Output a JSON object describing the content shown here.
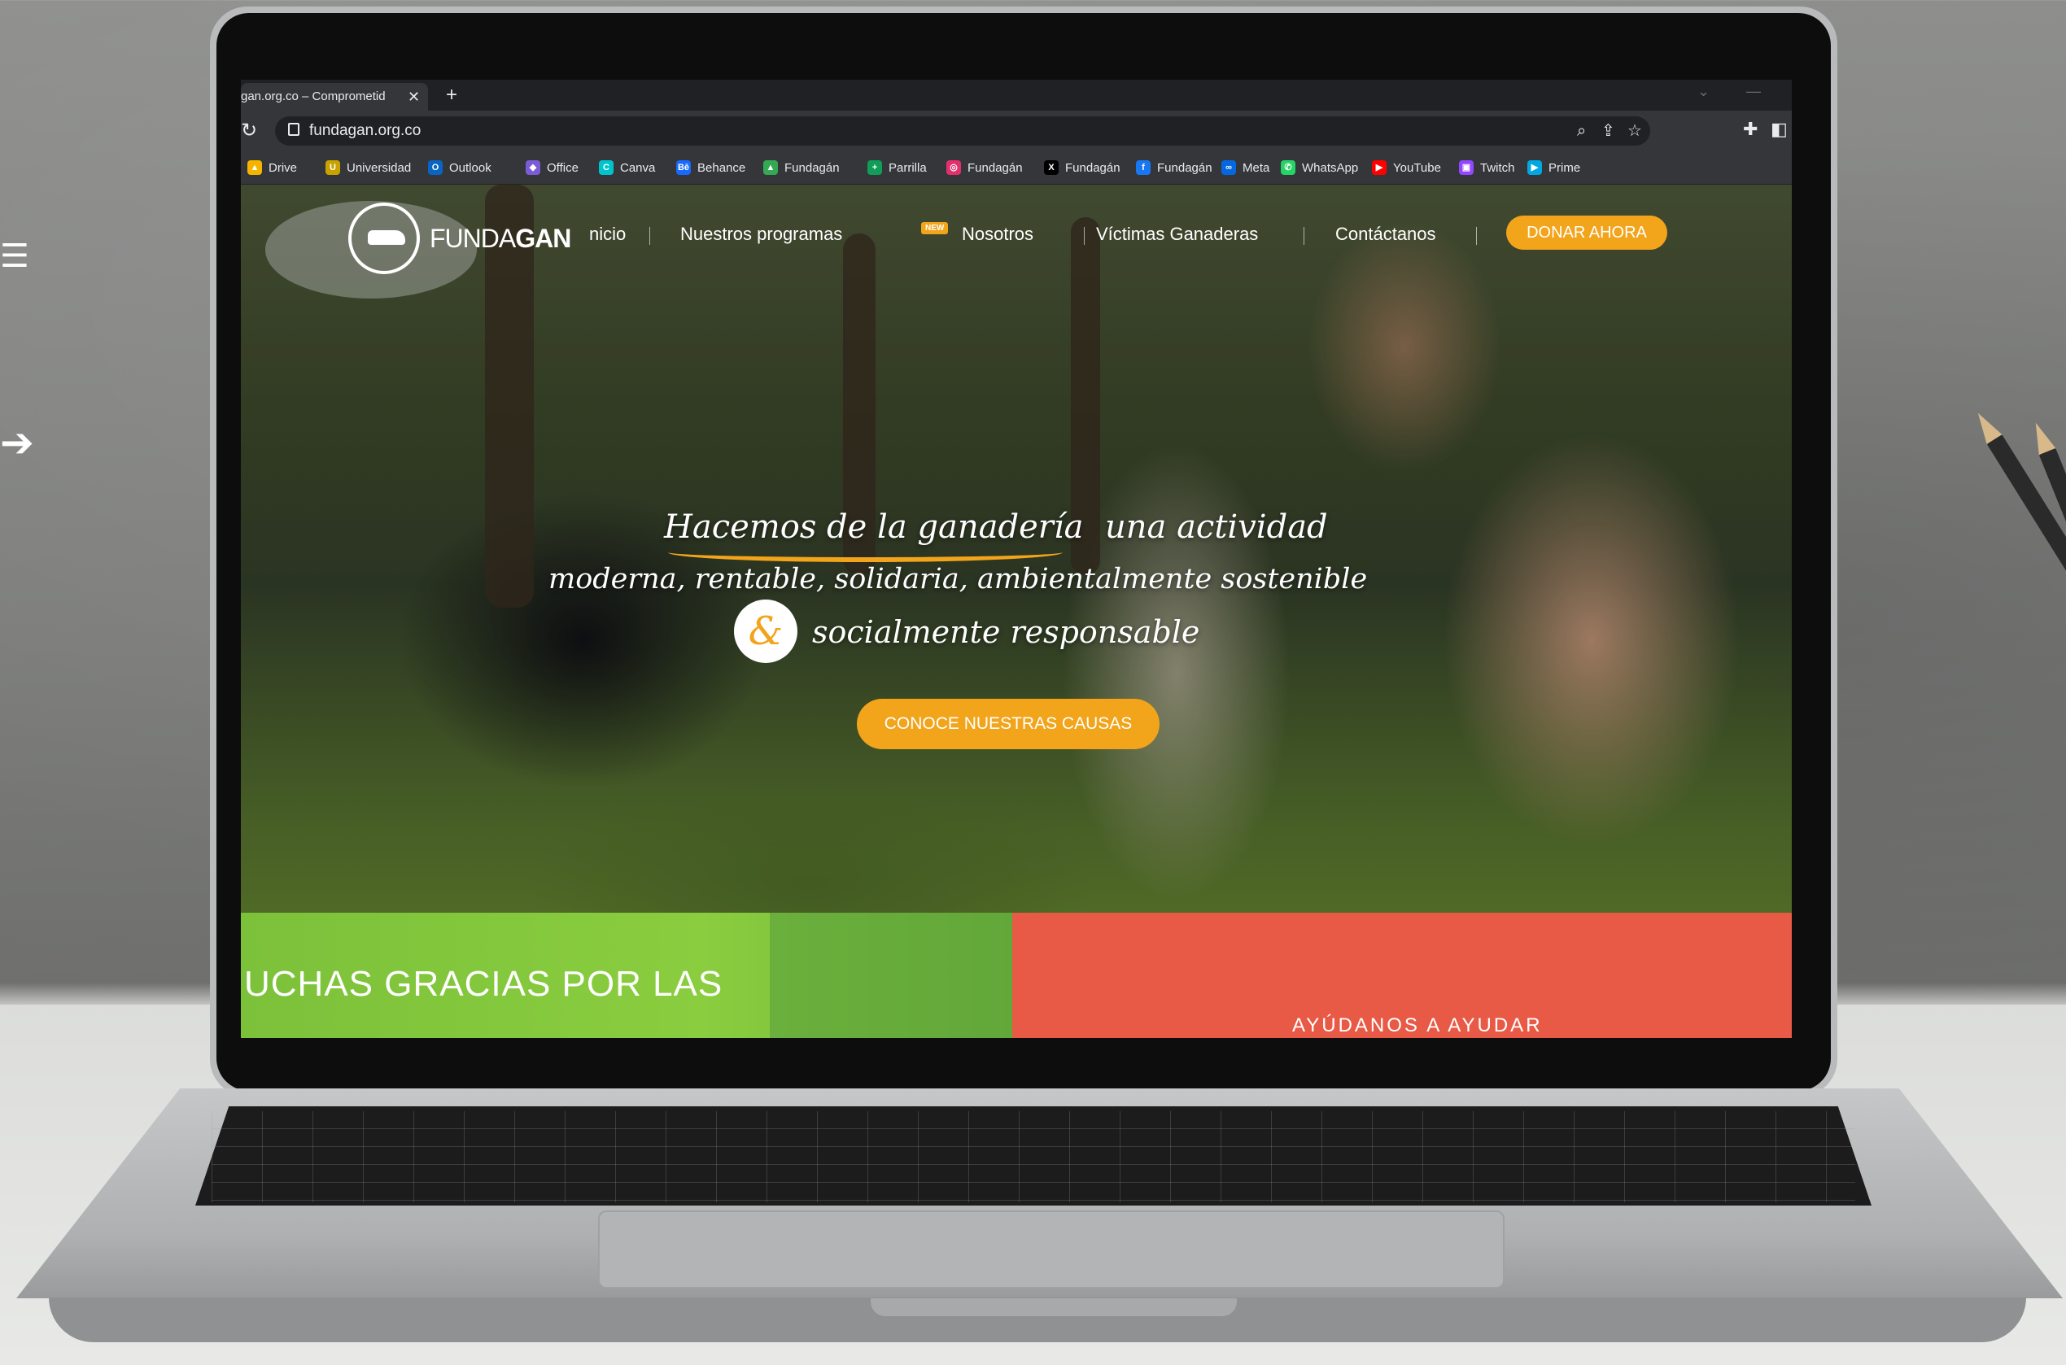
{
  "browser": {
    "tab_title": "gan.org.co – Comprometid",
    "tab_close": "✕",
    "new_tab": "+",
    "url": "fundagan.org.co",
    "bookmarks": [
      {
        "label": "Drive",
        "icon": "google-drive-icon",
        "color": "#f4b400",
        "glyph": "▲"
      },
      {
        "label": "Universidad",
        "icon": "university-shield-icon",
        "color": "#c8a200",
        "glyph": "U"
      },
      {
        "label": "Outlook",
        "icon": "outlook-icon",
        "color": "#0a64c2",
        "glyph": "O"
      },
      {
        "label": "Office",
        "icon": "office-icon",
        "color": "#7b5cd6",
        "glyph": "◆"
      },
      {
        "label": "Canva",
        "icon": "canva-icon",
        "color": "#00c4cc",
        "glyph": "C"
      },
      {
        "label": "Behance",
        "icon": "behance-icon",
        "color": "#1769ff",
        "glyph": "Bē"
      },
      {
        "label": "Fundagán",
        "icon": "google-drive-icon",
        "color": "#34a853",
        "glyph": "▲"
      },
      {
        "label": "Parrilla",
        "icon": "google-sheets-icon",
        "color": "#0f9d58",
        "glyph": "+"
      },
      {
        "label": "Fundagán",
        "icon": "instagram-icon",
        "color": "#e1306c",
        "glyph": "◎"
      },
      {
        "label": "Fundagán",
        "icon": "x-twitter-icon",
        "color": "#000000",
        "glyph": "X"
      },
      {
        "label": "Fundagán",
        "icon": "facebook-icon",
        "color": "#1877f2",
        "glyph": "f"
      },
      {
        "label": "Meta",
        "icon": "meta-icon",
        "color": "#0668e1",
        "glyph": "∞"
      },
      {
        "label": "WhatsApp",
        "icon": "whatsapp-icon",
        "color": "#25d366",
        "glyph": "✆"
      },
      {
        "label": "YouTube",
        "icon": "youtube-icon",
        "color": "#ff0000",
        "glyph": "▶"
      },
      {
        "label": "Twitch",
        "icon": "twitch-icon",
        "color": "#9146ff",
        "glyph": "▣"
      },
      {
        "label": "Prime",
        "icon": "prime-video-icon",
        "color": "#00a8e1",
        "glyph": "▶"
      }
    ]
  },
  "site": {
    "logo_text_light": "FUNDA",
    "logo_text_bold": "GAN",
    "nav": {
      "inicio": "nicio",
      "programs": "Nuestros programas",
      "new_badge": "NEW",
      "about": "Nosotros",
      "victims": "Víctimas Ganaderas",
      "contact": "Contáctanos",
      "donate": "DONAR AHORA"
    },
    "headline": {
      "line1a": "Hacemos de la ganadería",
      "line1b": "una actividad",
      "line2": "moderna, rentable, solidaria, ambientalmente sostenible",
      "amp": "&",
      "line3": "socialmente responsable"
    },
    "cta": "CONOCE NUESTRAS CAUSAS",
    "band_left": "UCHAS GRACIAS POR LAS",
    "band_right": "AYÚDANOS A AYUDAR"
  },
  "colors": {
    "accent": "#f2a41b",
    "green_band": "#7cc13a",
    "red_band": "#e85a45"
  }
}
